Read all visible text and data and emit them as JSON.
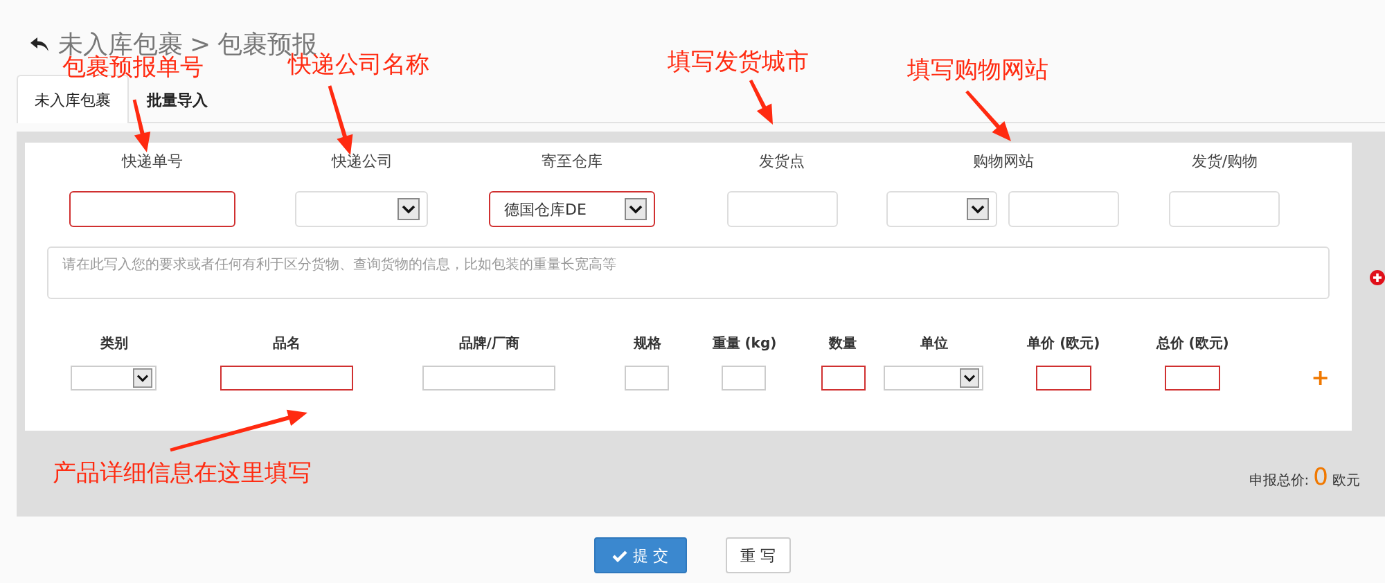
{
  "breadcrumb": {
    "parent": "未入库包裹",
    "separator": ">",
    "current": "包裹预报"
  },
  "tabs": [
    {
      "label": "未入库包裹",
      "selected": true
    },
    {
      "label": "批量导入",
      "selected": false
    }
  ],
  "shipment_fields": [
    {
      "label": "快递单号",
      "kind": "input",
      "required": true
    },
    {
      "label": "快递公司",
      "kind": "select",
      "required": false
    },
    {
      "label": "寄至仓库",
      "kind": "select",
      "required": true,
      "value": "德国仓库DE"
    },
    {
      "label": "发货点",
      "kind": "input",
      "required": false
    },
    {
      "label": "购物网站",
      "kind": "combo",
      "required": false
    },
    {
      "label": "发货/购物",
      "kind": "input",
      "required": false
    }
  ],
  "remarks": {
    "placeholder": "请在此写入您的要求或者任何有利于区分货物、查询货物的信息，比如包装的重量长宽高等"
  },
  "product_columns": [
    {
      "label": "类别",
      "kind": "select",
      "required": false
    },
    {
      "label": "品名",
      "kind": "wide",
      "required": true
    },
    {
      "label": "品牌/厂商",
      "kind": "wide",
      "required": false
    },
    {
      "label": "规格",
      "kind": "narrow",
      "required": false
    },
    {
      "label": "重量 (kg)",
      "kind": "narrow",
      "required": false
    },
    {
      "label": "数量",
      "kind": "narrow",
      "required": true
    },
    {
      "label": "单位",
      "kind": "select",
      "required": false
    },
    {
      "label": "单价 (欧元)",
      "kind": "medium",
      "required": true
    },
    {
      "label": "总价 (欧元)",
      "kind": "medium",
      "required": true
    }
  ],
  "add_row": "+",
  "total": {
    "label": "申报总价:",
    "value": "0",
    "unit": "欧元"
  },
  "buttons": [
    {
      "label": "提 交",
      "kind": "primary"
    },
    {
      "label": "重 写",
      "kind": "default"
    }
  ],
  "annotations": [
    "包裹预报单号",
    "快递公司名称",
    "填写发货城市",
    "填写购物网站",
    "产品详细信息在这里填写"
  ]
}
